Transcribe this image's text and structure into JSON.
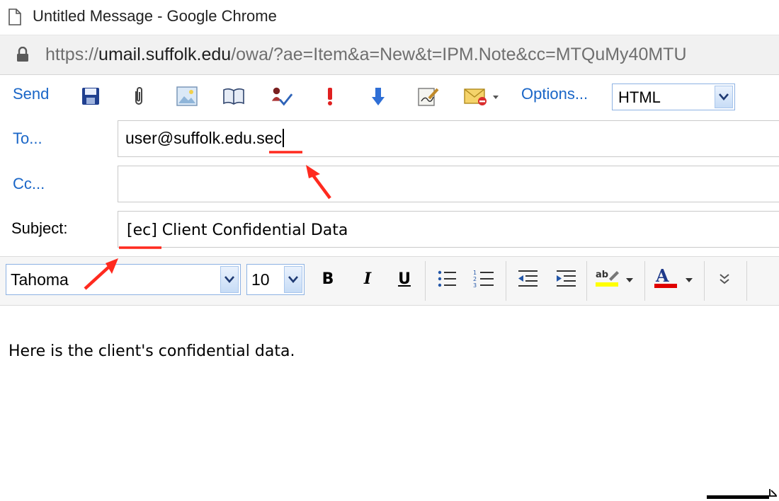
{
  "window": {
    "title": "Untitled Message - Google Chrome"
  },
  "address": {
    "scheme": "https://",
    "host": "umail.suffolk.edu",
    "path": "/owa/?ae=Item&a=New&t=IPM.Note&cc=MTQuMy40MTU"
  },
  "toolbar": {
    "send_label": "Send",
    "options_label": "Options...",
    "format_value": "HTML",
    "icons": [
      "save-icon",
      "attach-icon",
      "insert-image-icon",
      "address-book-icon",
      "check-names-icon",
      "high-importance-icon",
      "low-importance-icon",
      "signature-icon",
      "message-flag-icon"
    ]
  },
  "header": {
    "to_label": "To...",
    "to_value": "user@suffolk.edu.sec",
    "cc_label": "Cc...",
    "cc_value": "",
    "subject_label": "Subject:",
    "subject_value": "[ec] Client Confidential Data"
  },
  "format": {
    "font_value": "Tahoma",
    "size_value": "10",
    "bold": "B",
    "italic": "I",
    "underline": "U",
    "font_color_letter": "A",
    "highlight_letters": "ab"
  },
  "body": {
    "text": "Here is the client's confidential data."
  },
  "colors": {
    "link": "#1a66c7",
    "annotation": "#ff2a1f",
    "highlight": "#ffff00",
    "font_color": "#e00000"
  }
}
